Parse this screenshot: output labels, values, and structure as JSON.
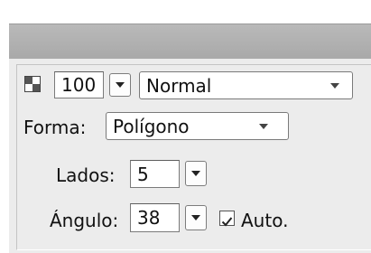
{
  "panel": {
    "opacity_value": "100",
    "blend_mode": "Normal",
    "forma_label": "Forma:",
    "forma_value": "Polígono",
    "lados_label": "Lados:",
    "lados_value": "5",
    "angulo_label": "Ángulo:",
    "angulo_value": "38",
    "auto_label": "Auto.",
    "auto_checked": true
  },
  "colors": {
    "titlebar": "#b0b0b0",
    "panel_bg": "#ececec"
  }
}
